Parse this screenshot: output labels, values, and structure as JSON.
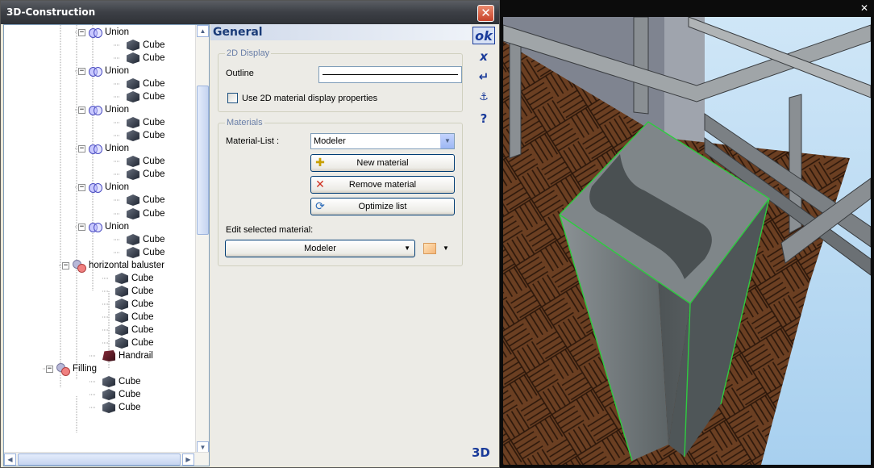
{
  "window": {
    "title": "3D-Construction",
    "close_icon": "close-icon"
  },
  "tree": {
    "items": [
      {
        "label": "Union",
        "icon": "union-icon",
        "expander": "−"
      },
      {
        "label": "Cube",
        "icon": "cube-icon"
      },
      {
        "label": "Cube",
        "icon": "cube-icon"
      },
      {
        "label": "Union",
        "icon": "union-icon",
        "expander": "−"
      },
      {
        "label": "Cube",
        "icon": "cube-icon"
      },
      {
        "label": "Cube",
        "icon": "cube-icon"
      },
      {
        "label": "Union",
        "icon": "union-icon",
        "expander": "−"
      },
      {
        "label": "Cube",
        "icon": "cube-icon"
      },
      {
        "label": "Cube",
        "icon": "cube-icon"
      },
      {
        "label": "Union",
        "icon": "union-icon",
        "expander": "−"
      },
      {
        "label": "Cube",
        "icon": "cube-icon"
      },
      {
        "label": "Cube",
        "icon": "cube-icon"
      },
      {
        "label": "Union",
        "icon": "union-icon",
        "expander": "−"
      },
      {
        "label": "Cube",
        "icon": "cube-icon"
      },
      {
        "label": "Cube",
        "icon": "cube-icon"
      },
      {
        "label": "Union",
        "icon": "union-icon",
        "expander": "−"
      },
      {
        "label": "Cube",
        "icon": "cube-icon"
      },
      {
        "label": "Cube",
        "icon": "cube-icon"
      },
      {
        "label": "horizontal baluster",
        "icon": "group-icon",
        "expander": "−"
      },
      {
        "label": "Cube",
        "icon": "cube-icon"
      },
      {
        "label": "Cube",
        "icon": "cube-icon"
      },
      {
        "label": "Cube",
        "icon": "cube-icon"
      },
      {
        "label": "Cube",
        "icon": "cube-icon"
      },
      {
        "label": "Cube",
        "icon": "cube-icon"
      },
      {
        "label": "Cube",
        "icon": "cube-icon"
      },
      {
        "label": "Handrail",
        "icon": "handrail-icon"
      },
      {
        "label": "Filling",
        "icon": "group-icon",
        "expander": "−"
      },
      {
        "label": "Cube",
        "icon": "cube-icon"
      },
      {
        "label": "Cube",
        "icon": "cube-icon"
      },
      {
        "label": "Cube",
        "icon": "cube-icon"
      }
    ]
  },
  "panel": {
    "header": "General",
    "display_group": {
      "title": "2D Display",
      "outline_label": "Outline",
      "checkbox_label": "Use 2D material display properties",
      "checkbox_checked": false
    },
    "materials_group": {
      "title": "Materials",
      "list_label": "Material-List :",
      "list_value": "Modeler",
      "new_button": "New material",
      "remove_button": "Remove material",
      "optimize_button": "Optimize list",
      "edit_label": "Edit selected material:",
      "edit_value": "Modeler"
    }
  },
  "actions": {
    "ok": "ok",
    "cancel": "x",
    "apply": "↵",
    "save": "⚓",
    "help": "?",
    "mode_3d": "3D"
  },
  "colors": {
    "accent": "#1a3b9a",
    "titlebar": "#3c3f45",
    "selection_edge": "#2ecc40",
    "sky": "#cfe6f7",
    "wood": "#6b3f22"
  }
}
